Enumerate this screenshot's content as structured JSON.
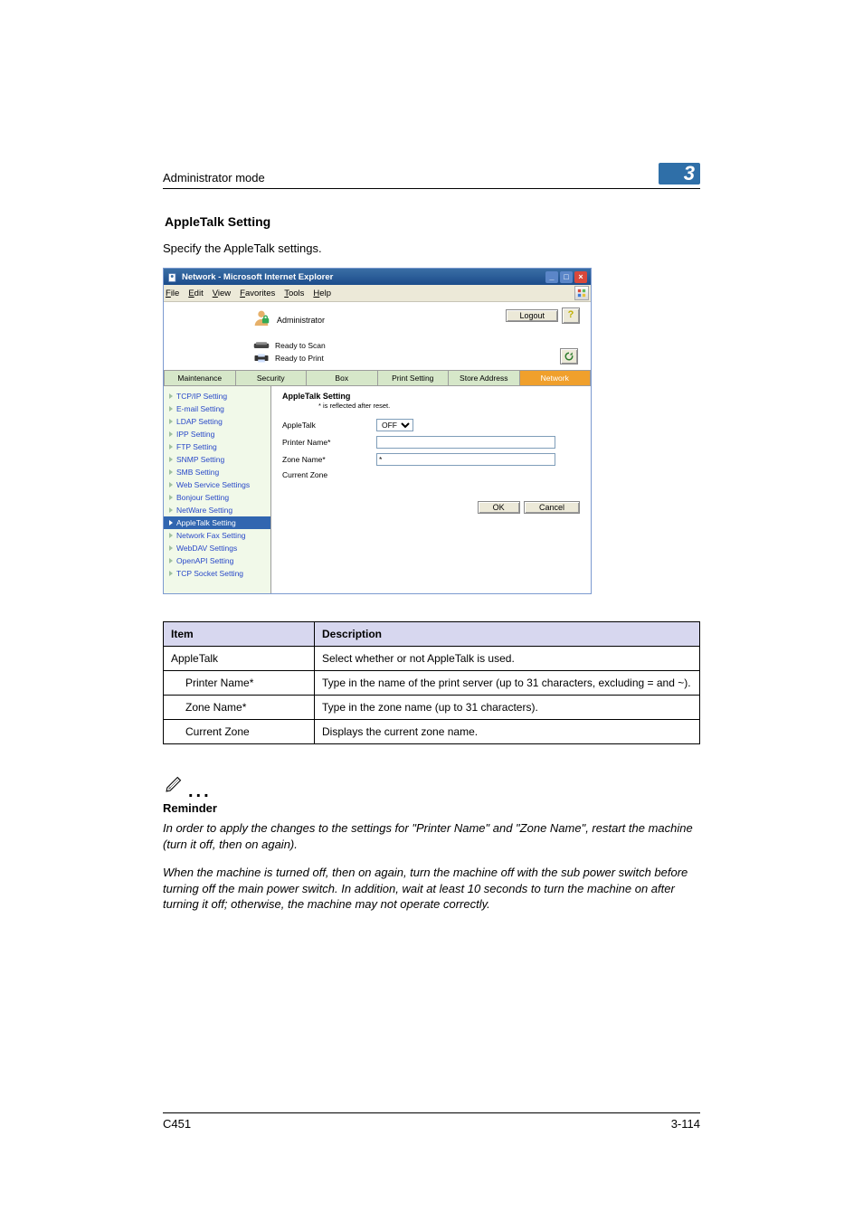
{
  "header": {
    "title": "Administrator mode",
    "chapter": "3"
  },
  "section": {
    "title": "AppleTalk Setting",
    "intro": "Specify the AppleTalk settings."
  },
  "screenshot": {
    "window_title": "Network - Microsoft Internet Explorer",
    "menu": [
      "File",
      "Edit",
      "View",
      "Favorites",
      "Tools",
      "Help"
    ],
    "admin_label": "Administrator",
    "logout_label": "Logout",
    "help_icon": "help-icon",
    "status_scan": "Ready to Scan",
    "status_print": "Ready to Print",
    "refresh_icon": "refresh-icon",
    "tabs": [
      "Maintenance",
      "Security",
      "Box",
      "Print Setting",
      "Store Address",
      "Network"
    ],
    "active_tab_index": 5,
    "nav": [
      "TCP/IP Setting",
      "E-mail Setting",
      "LDAP Setting",
      "IPP Setting",
      "FTP Setting",
      "SNMP Setting",
      "SMB Setting",
      "Web Service Settings",
      "Bonjour Setting",
      "NetWare Setting",
      "AppleTalk Setting",
      "Network Fax Setting",
      "WebDAV Settings",
      "OpenAPI Setting",
      "TCP Socket Setting"
    ],
    "selected_nav_index": 10,
    "panel": {
      "title": "AppleTalk Setting",
      "note": "* is reflected after reset.",
      "fields": {
        "appletalk_label": "AppleTalk",
        "appletalk_value": "OFF",
        "printer_name_label": "Printer Name*",
        "printer_name_value": "",
        "zone_name_label": "Zone Name*",
        "zone_name_value": "*",
        "current_zone_label": "Current Zone",
        "current_zone_value": ""
      },
      "ok_label": "OK",
      "cancel_label": "Cancel"
    }
  },
  "table": {
    "head_item": "Item",
    "head_desc": "Description",
    "rows": [
      {
        "item": "AppleTalk",
        "indent": false,
        "desc": "Select whether or not AppleTalk is used."
      },
      {
        "item": "Printer Name*",
        "indent": true,
        "desc": "Type in the name of the print server (up to 31 characters, excluding = and ~)."
      },
      {
        "item": "Zone Name*",
        "indent": true,
        "desc": "Type in the zone name (up to 31 characters)."
      },
      {
        "item": "Current Zone",
        "indent": true,
        "desc": "Displays the current zone name."
      }
    ]
  },
  "note": {
    "reminder_label": "Reminder",
    "para1": "In order to apply the changes to the settings for \"Printer Name\" and \"Zone Name\", restart the machine (turn it off, then on again).",
    "para2": "When the machine is turned off, then on again, turn the machine off with the sub power switch before turning off the main power switch. In addition, wait at least 10 seconds to turn the machine on after turning it off; otherwise, the machine may not operate correctly."
  },
  "footer": {
    "left": "C451",
    "right": "3-114"
  }
}
